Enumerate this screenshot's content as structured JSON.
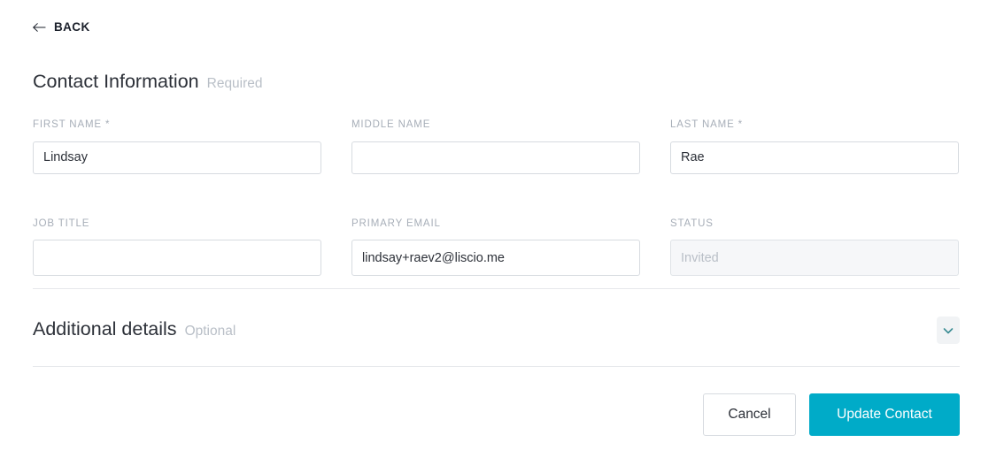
{
  "back": {
    "label": "BACK",
    "icon": "arrow-left-icon"
  },
  "contact_section": {
    "title": "Contact Information",
    "subtitle": "Required"
  },
  "additional_section": {
    "title": "Additional details",
    "subtitle": "Optional",
    "toggle_icon": "chevron-down-icon"
  },
  "fields": [
    {
      "label": "FIRST NAME",
      "required_marker": " *",
      "value": "Lindsay",
      "placeholder": "",
      "disabled": false
    },
    {
      "label": "MIDDLE NAME",
      "required_marker": "",
      "value": "",
      "placeholder": "",
      "disabled": false
    },
    {
      "label": "LAST NAME",
      "required_marker": " *",
      "value": "Rae",
      "placeholder": "",
      "disabled": false
    },
    {
      "label": "JOB TITLE",
      "required_marker": "",
      "value": "",
      "placeholder": "",
      "disabled": false
    },
    {
      "label": "PRIMARY EMAIL",
      "required_marker": "",
      "value": "lindsay+raev2@liscio.me",
      "placeholder": "",
      "disabled": false
    },
    {
      "label": "STATUS",
      "required_marker": "",
      "value": "",
      "placeholder": "Invited",
      "disabled": true
    }
  ],
  "footer": {
    "cancel_label": "Cancel",
    "submit_label": "Update Contact"
  },
  "colors": {
    "primary": "#00abc8",
    "heading": "#2c3038",
    "muted": "#b9bfc7",
    "label": "#a7aeb8",
    "border": "#d7dbe0",
    "divider": "#e6e8eb",
    "chevron": "#3a8c93",
    "disabled_bg": "#f6f7f9"
  }
}
